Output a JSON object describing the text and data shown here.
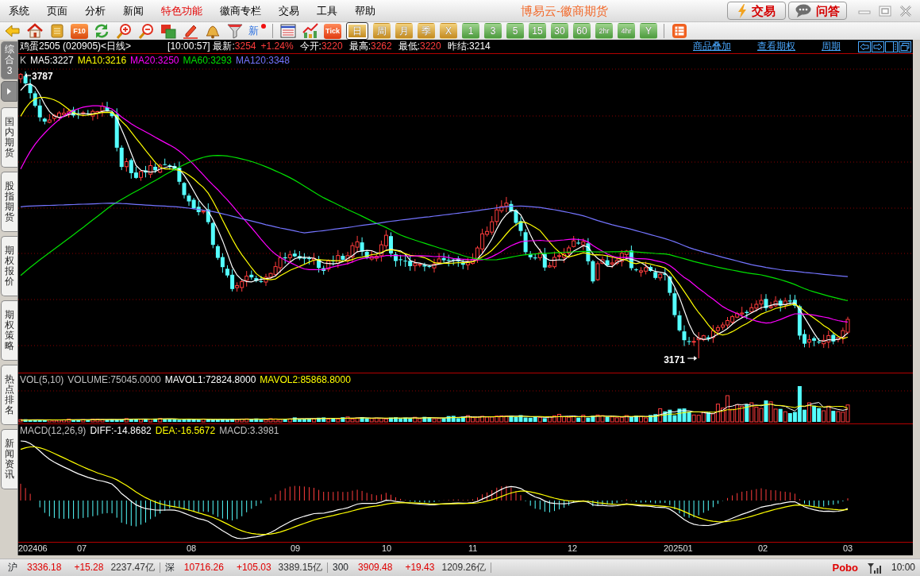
{
  "window": {
    "title": "博易云-徽商期货"
  },
  "menu": [
    {
      "label": "系统",
      "highlighted": false
    },
    {
      "label": "页面",
      "highlighted": false
    },
    {
      "label": "分析",
      "highlighted": false
    },
    {
      "label": "新闻",
      "highlighted": false
    },
    {
      "label": "特色功能",
      "highlighted": true
    },
    {
      "label": "徽商专栏",
      "highlighted": false
    },
    {
      "label": "交易",
      "highlighted": false
    },
    {
      "label": "工具",
      "highlighted": false
    },
    {
      "label": "帮助",
      "highlighted": false
    }
  ],
  "header_buttons": [
    {
      "label": "交易",
      "kind": "trade"
    },
    {
      "label": "问答",
      "kind": "qa"
    }
  ],
  "toolbar": {
    "f10_label": "F10",
    "news_label": "新",
    "news_unread": true,
    "tick_label": "Tick",
    "periods": [
      {
        "label": "日",
        "kind": "gold",
        "selected": true
      },
      {
        "label": "周",
        "kind": "gold",
        "selected": false
      },
      {
        "label": "月",
        "kind": "gold",
        "selected": false
      },
      {
        "label": "季",
        "kind": "gold",
        "selected": false
      },
      {
        "label": "X",
        "kind": "gold",
        "selected": false
      },
      {
        "label": "1",
        "kind": "green",
        "selected": false
      },
      {
        "label": "3",
        "kind": "green",
        "selected": false
      },
      {
        "label": "5",
        "kind": "green",
        "selected": false
      },
      {
        "label": "15",
        "kind": "green",
        "selected": false
      },
      {
        "label": "30",
        "kind": "green",
        "selected": false
      },
      {
        "label": "60",
        "kind": "green",
        "selected": false
      },
      {
        "label": "2hr",
        "kind": "green",
        "selected": false
      },
      {
        "label": "4hr",
        "kind": "green",
        "selected": false
      },
      {
        "label": "Y",
        "kind": "green",
        "selected": false
      }
    ]
  },
  "side_tabs": [
    {
      "label": "综合3",
      "selected": true
    },
    {
      "label": "国内期货",
      "selected": false
    },
    {
      "label": "股指期货",
      "selected": false
    },
    {
      "label": "期权报价",
      "selected": false
    },
    {
      "label": "期权策略",
      "selected": false
    },
    {
      "label": "热点排名",
      "selected": false
    },
    {
      "label": "新闻资讯",
      "selected": false
    }
  ],
  "quote": {
    "title": "鸡蛋2505 (020905)<日线>",
    "time": "[10:00:57]",
    "fields": [
      {
        "label": "最新:",
        "value": "3254",
        "change": "+1.24%",
        "rising": true
      },
      {
        "label": "今开:",
        "value": "3220",
        "rising": true
      },
      {
        "label": "最高:",
        "value": "3262",
        "rising": true
      },
      {
        "label": "最低:",
        "value": "3220",
        "rising": true
      },
      {
        "label": "昨结:",
        "value": "3214",
        "rising": false
      }
    ],
    "links": [
      "商品叠加",
      "查看期权",
      "周期"
    ]
  },
  "price_panel": {
    "legend": [
      {
        "label": "K",
        "color": "#c0c0c0"
      },
      {
        "label": "MA5:3227",
        "color": "#ffffff"
      },
      {
        "label": "MA10:3216",
        "color": "#ffff00"
      },
      {
        "label": "MA20:3250",
        "color": "#ff00ff"
      },
      {
        "label": "MA60:3293",
        "color": "#00e000"
      },
      {
        "label": "MA120:3348",
        "color": "#7474ff"
      }
    ],
    "high_label": "3787",
    "low_label": "3171"
  },
  "volume_panel": {
    "legend": [
      {
        "label": "VOL(5,10)",
        "color": "#c0c0c0"
      },
      {
        "label": "VOLUME:75045.0000",
        "color": "#c0c0c0"
      },
      {
        "label": "MAVOL1:72824.8000",
        "color": "#ffffff"
      },
      {
        "label": "MAVOL2:85868.8000",
        "color": "#ffff00"
      }
    ]
  },
  "macd_panel": {
    "legend": [
      {
        "label": "MACD(12,26,9)",
        "color": "#c0c0c0"
      },
      {
        "label": "DIFF:-14.8682",
        "color": "#ffffff"
      },
      {
        "label": "DEA:-16.5672",
        "color": "#ffff00"
      },
      {
        "label": "MACD:3.3981",
        "color": "#c0c0c0"
      }
    ]
  },
  "x_axis": [
    "202406",
    "07",
    "08",
    "09",
    "10",
    "11",
    "12",
    "202501",
    "02",
    "03"
  ],
  "status_bar": {
    "indices": [
      {
        "name": "沪",
        "value": "3336.18",
        "change": "+15.28",
        "amount": "2237.47亿",
        "rising": true
      },
      {
        "name": "深",
        "value": "10716.26",
        "change": "+105.03",
        "amount": "3389.15亿",
        "rising": true
      },
      {
        "name": "300",
        "value": "3909.48",
        "change": "+19.43",
        "amount": "1209.26亿",
        "rising": true
      }
    ],
    "brand": "Pobo",
    "time": "10:00"
  }
}
